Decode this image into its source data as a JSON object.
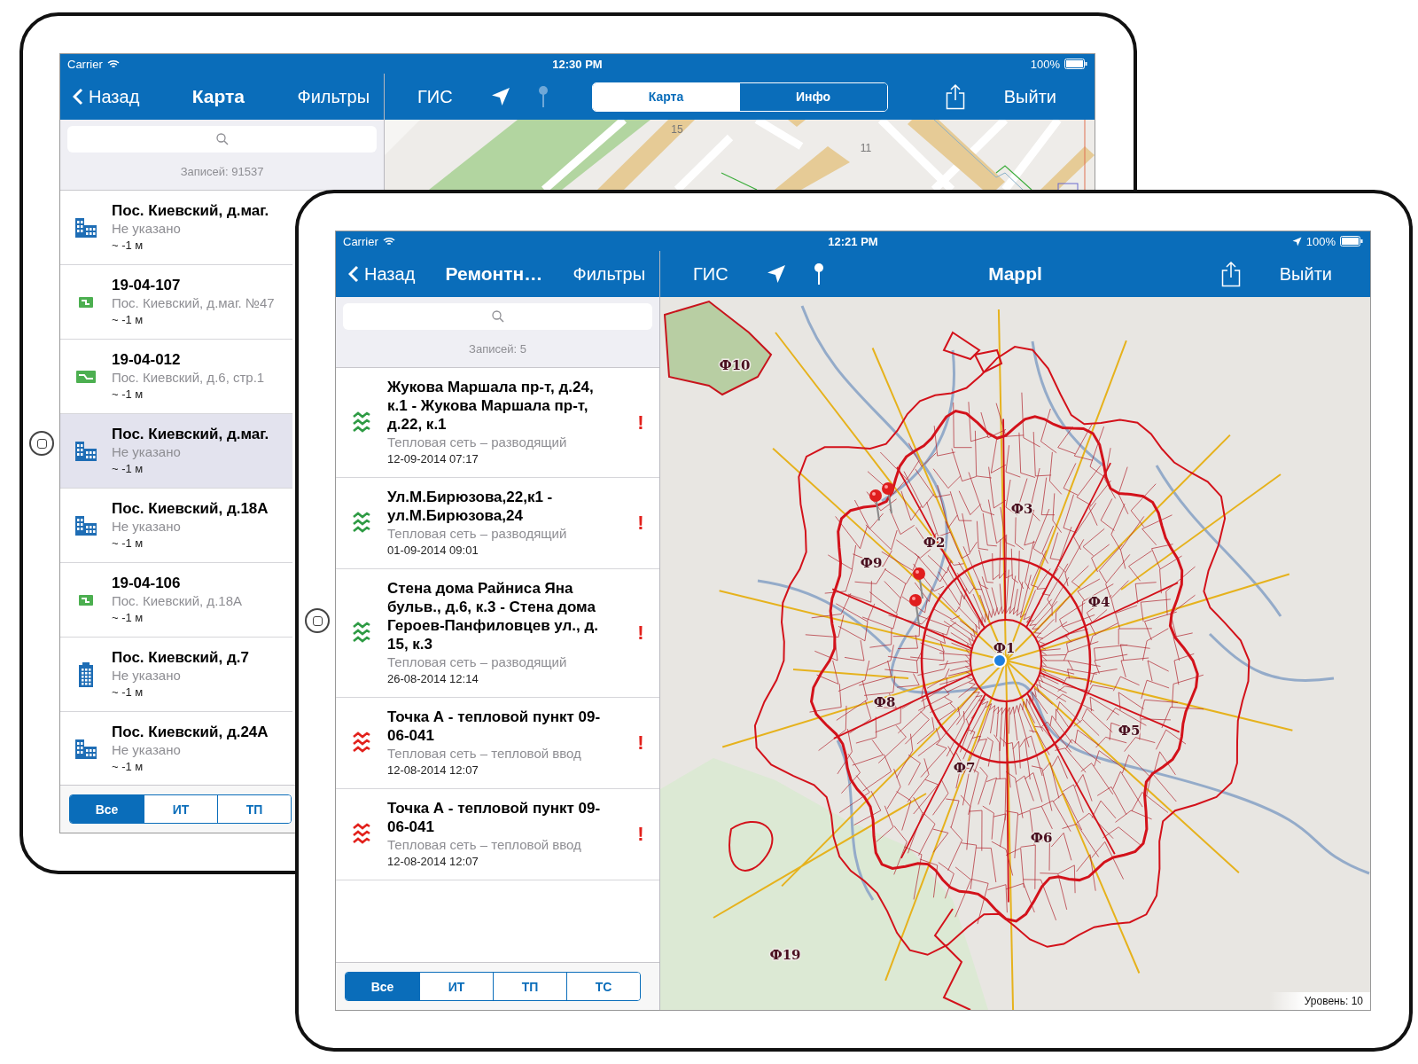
{
  "back_tablet": {
    "status_bar": {
      "carrier": "Carrier",
      "time": "12:30 PM",
      "battery": "100%"
    },
    "sidebar": {
      "back": "Назад",
      "title": "Карта",
      "filters": "Фильтры",
      "records": "Записей: 91537",
      "items": [
        {
          "kind": "building",
          "title": "Пос. Киевский, д.маг.",
          "subtitle": "Не указано",
          "distance": "~ -1 м",
          "selected": false
        },
        {
          "kind": "tag",
          "title": "19-04-107",
          "subtitle": "Пос. Киевский, д.маг. №47",
          "distance": "~ -1 м",
          "selected": false
        },
        {
          "kind": "plate",
          "title": "19-04-012",
          "subtitle": "Пос. Киевский, д.6, стр.1",
          "distance": "~ -1 м",
          "selected": false
        },
        {
          "kind": "building",
          "title": "Пос. Киевский, д.маг.",
          "subtitle": "Не указано",
          "distance": "~ -1 м",
          "selected": true
        },
        {
          "kind": "building",
          "title": "Пос. Киевский, д.18А",
          "subtitle": "Не указано",
          "distance": "~ -1 м",
          "selected": false
        },
        {
          "kind": "tag",
          "title": "19-04-106",
          "subtitle": "Пос. Киевский, д.18А",
          "distance": "~ -1 м",
          "selected": false
        },
        {
          "kind": "tower",
          "title": "Пос. Киевский, д.7",
          "subtitle": "Не указано",
          "distance": "~ -1 м",
          "selected": false
        },
        {
          "kind": "building",
          "title": "Пос. Киевский, д.24А",
          "subtitle": "Не указано",
          "distance": "~ -1 м",
          "selected": false
        }
      ],
      "tabs": [
        {
          "label": "Все",
          "selected": true
        },
        {
          "label": "ИТ",
          "selected": false
        },
        {
          "label": "ТП",
          "selected": false
        }
      ]
    },
    "toolbar": {
      "gis": "ГИС",
      "pin_disabled": true,
      "segments": [
        {
          "label": "Карта",
          "selected": true
        },
        {
          "label": "Инфо",
          "selected": false
        }
      ],
      "logout": "Выйти"
    },
    "map": {
      "kind": "street",
      "labels": [
        "15",
        "11"
      ]
    }
  },
  "front_tablet": {
    "status_bar": {
      "carrier": "Carrier",
      "time": "12:21 PM",
      "battery": "100%",
      "location_active": true
    },
    "sidebar": {
      "back": "Назад",
      "title": "Ремонтн…",
      "filters": "Фильтры",
      "records": "Записей: 5",
      "items": [
        {
          "kind": "wave",
          "color": "#2e9b44",
          "title": "Жукова Маршала пр-т, д.24, к.1 - Жукова Маршала пр-т, д.22, к.1",
          "subtitle": "Тепловая сеть – разводящий",
          "date": "12-09-2014 07:17",
          "alert": "!"
        },
        {
          "kind": "wave",
          "color": "#2e9b44",
          "title": "Ул.М.Бирюзова,22,к1 - ул.М.Бирюзова,24",
          "subtitle": "Тепловая сеть – разводящий",
          "date": "01-09-2014 09:01",
          "alert": "!"
        },
        {
          "kind": "wave",
          "color": "#2e9b44",
          "title": "Стена дома Райниса Яна бульв., д.6, к.3 - Стена дома Героев-Панфиловцев ул., д. 15, к.3",
          "subtitle": "Тепловая сеть – разводящий",
          "date": "26-08-2014 12:14",
          "alert": "!"
        },
        {
          "kind": "wave",
          "color": "#e2211c",
          "title": "Точка А - тепловой пункт 09-06-041",
          "subtitle": "Тепловая сеть – тепловой ввод",
          "date": "12-08-2014 12:07",
          "alert": "!"
        },
        {
          "kind": "wave",
          "color": "#e2211c",
          "title": "Точка А - тепловой пункт 09-06-041",
          "subtitle": "Тепловая сеть – тепловой ввод",
          "date": "12-08-2014 12:07",
          "alert": "!"
        }
      ],
      "tabs": [
        {
          "label": "Все",
          "selected": true
        },
        {
          "label": "ИТ",
          "selected": false
        },
        {
          "label": "ТП",
          "selected": false
        },
        {
          "label": "ТС",
          "selected": false
        }
      ]
    },
    "toolbar": {
      "gis": "ГИС",
      "pin_disabled": false,
      "title": "Mappl",
      "logout": "Выйти"
    },
    "map": {
      "kind": "city",
      "labels": [
        "Ф10",
        "Ф3",
        "Ф2",
        "Ф9",
        "Ф4",
        "Ф1",
        "Ф8",
        "Ф5",
        "Ф7",
        "Ф6",
        "Ф19"
      ],
      "zoom_text": "Уровень: 10"
    }
  }
}
